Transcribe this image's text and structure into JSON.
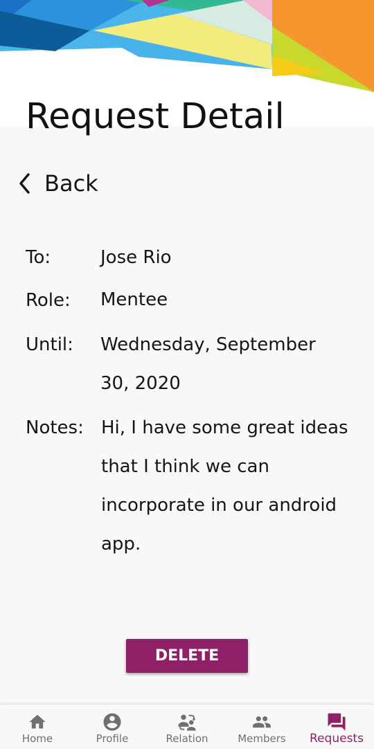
{
  "header": {
    "title": "Request Detail"
  },
  "back": {
    "label": "Back",
    "icon": "chevron-left-icon"
  },
  "request": {
    "to_label": "To:",
    "to_value": "Jose Rio",
    "role_label": "Role:",
    "role_value": "Mentee",
    "until_label": "Until:",
    "until_value": "Wednesday, September 30, 2020",
    "notes_label": "Notes:",
    "notes_value": "Hi, I have some great ideas that I think we can incorporate in our android app."
  },
  "actions": {
    "delete_label": "DELETE"
  },
  "bottom_nav": {
    "active_index": 4,
    "items": [
      {
        "label": "Home",
        "icon": "home-icon"
      },
      {
        "label": "Profile",
        "icon": "account-circle-icon"
      },
      {
        "label": "Relation",
        "icon": "people-sync-icon"
      },
      {
        "label": "Members",
        "icon": "group-icon"
      },
      {
        "label": "Requests",
        "icon": "forum-icon"
      }
    ]
  },
  "colors": {
    "accent": "#8f1f67",
    "background": "#f8f8f8",
    "text": "#151515",
    "nav_inactive": "#707070",
    "banner_orange": "#f7952e",
    "banner_blue": "#37a8e6",
    "banner_lime": "#c8d92c",
    "banner_teal": "#33b894"
  }
}
